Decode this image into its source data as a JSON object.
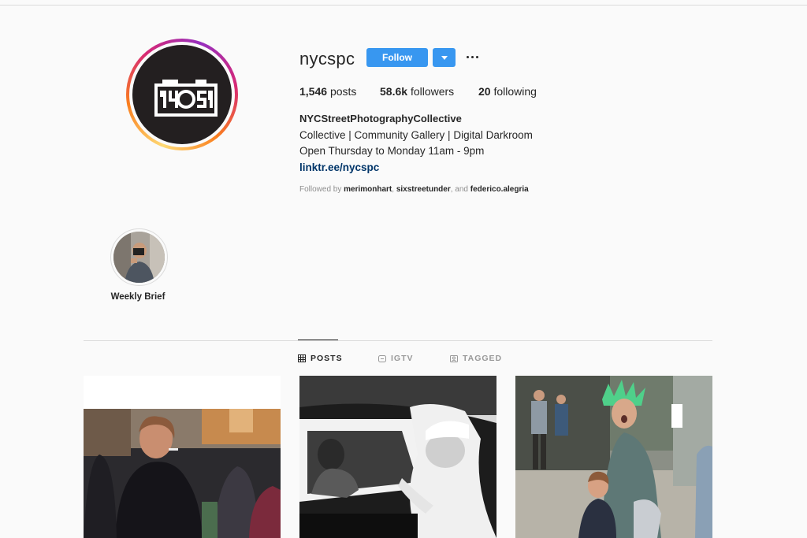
{
  "profile": {
    "username": "nycspc",
    "follow_label": "Follow",
    "stats": {
      "posts_count": "1,546",
      "posts_label": "posts",
      "followers_count": "58.6k",
      "followers_label": "followers",
      "following_count": "20",
      "following_label": "following"
    },
    "bio": {
      "name": "NYCStreetPhotographyCollective",
      "line1": "Collective | Community Gallery | Digital Darkroom",
      "line2": "Open Thursday to Monday 11am - 9pm",
      "link": "linktr.ee/nycspc"
    },
    "followed_by": {
      "prefix": "Followed by",
      "user1": "merimonhart",
      "sep": ",",
      "user2": "sixstreetunder",
      "and": ", and",
      "user3": "federico.alegria"
    },
    "logo_text": "NYCSPC"
  },
  "highlights": [
    {
      "label": "Weekly Brief"
    }
  ],
  "tabs": [
    {
      "label": "POSTS",
      "icon": "grid-icon",
      "active": true
    },
    {
      "label": "IGTV",
      "icon": "igtv-icon",
      "active": false
    },
    {
      "label": "TAGGED",
      "icon": "tagged-icon",
      "active": false
    }
  ],
  "colors": {
    "accent": "#3897f0",
    "link": "#003569",
    "text": "#262626",
    "muted": "#8e8e8e"
  }
}
